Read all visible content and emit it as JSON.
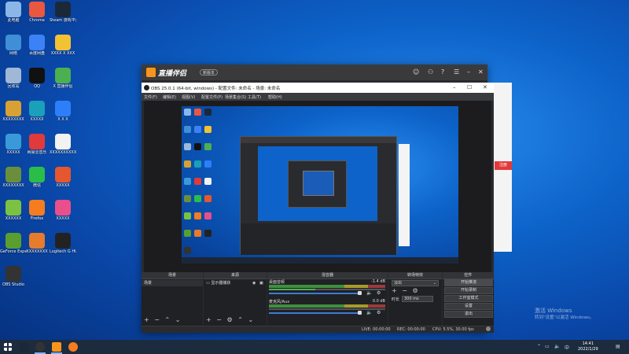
{
  "desktop": {
    "icons": [
      {
        "label": "此电脑",
        "color": "#8ab6e8"
      },
      {
        "label": "Chrome",
        "color": "#e9573f"
      },
      {
        "label": "Steam 游戏平台",
        "color": "#1b2838"
      },
      {
        "label": "网络",
        "color": "#3f8fd8"
      },
      {
        "label": "百度网盘",
        "color": "#3b82f6"
      },
      {
        "label": "XXXX X XXX",
        "color": "#f1c232"
      },
      {
        "label": "回收站",
        "color": "#9fb8d6"
      },
      {
        "label": "QQ",
        "color": "#111111"
      },
      {
        "label": "X 直播伴侣",
        "color": "#4caf50"
      },
      {
        "label": "XXXXXXXX",
        "color": "#d7a233"
      },
      {
        "label": "XXXXX",
        "color": "#1aa0b8"
      },
      {
        "label": "X X X",
        "color": "#2d7ff9"
      },
      {
        "label": "XXXXX",
        "color": "#3a9ad9"
      },
      {
        "label": "网易云音乐",
        "color": "#e03a3a"
      },
      {
        "label": "XXXXXXXXXX",
        "color": "#f2f2f2"
      },
      {
        "label": "XXXXXXXX",
        "color": "#6a8f3c"
      },
      {
        "label": "微信",
        "color": "#2bbd4a"
      },
      {
        "label": "XXXXX",
        "color": "#e5572e"
      },
      {
        "label": "XXXXXX",
        "color": "#7bc142"
      },
      {
        "label": "Firefox",
        "color": "#f57c1f"
      },
      {
        "label": "XXXXX",
        "color": "#e94f8a"
      },
      {
        "label": "GeForce Experience",
        "color": "#5a9e2f"
      },
      {
        "label": "XXXXXXXX",
        "color": "#e57b2c"
      },
      {
        "label": "Logitech G HUB",
        "color": "#222222"
      },
      {
        "label": "OBS Studio",
        "color": "#333333"
      }
    ]
  },
  "helper_window": {
    "name": "直播伴侣",
    "badge": "新版本"
  },
  "side_dialog": {
    "button_label": "注册"
  },
  "obs": {
    "title": "OBS 25.0.1 (64-bit, windows) - 配置文件: 未命名 - 场景: 未命名",
    "menu": [
      "文件(F)",
      "编辑(E)",
      "视图(V)",
      "配置文件(P)",
      "场景集合(S)",
      "工具(T)",
      "帮助(H)"
    ],
    "docks": {
      "scenes": "场景",
      "sources": "来源",
      "mixer": "混音器",
      "transitions": "转场特效",
      "controls": "控件"
    },
    "scene_items": [
      "场景"
    ],
    "source_items": [
      "显示器捕获"
    ],
    "mixer_tracks": [
      {
        "name": "桌面音频",
        "db": "-1.4 dB"
      },
      {
        "name": "麦克风/Aux",
        "db": "0.0 dB"
      }
    ],
    "transition": {
      "type": "淡出",
      "duration_label": "时长",
      "duration": "300 ms"
    },
    "controls": [
      "开始推流",
      "开始录制",
      "工作室模式",
      "设置",
      "退出"
    ],
    "status": {
      "live": "LIVE: 00:00:00",
      "rec": "REC: 00:00:00",
      "cpu": "CPU: 5.5%, 30.00 fps"
    }
  },
  "watermark": {
    "line1": "激活 Windows",
    "line2": "转到\"设置\"以激活 Windows。"
  },
  "taskbar": {
    "time": "14:41",
    "date": "2022/1/29"
  }
}
